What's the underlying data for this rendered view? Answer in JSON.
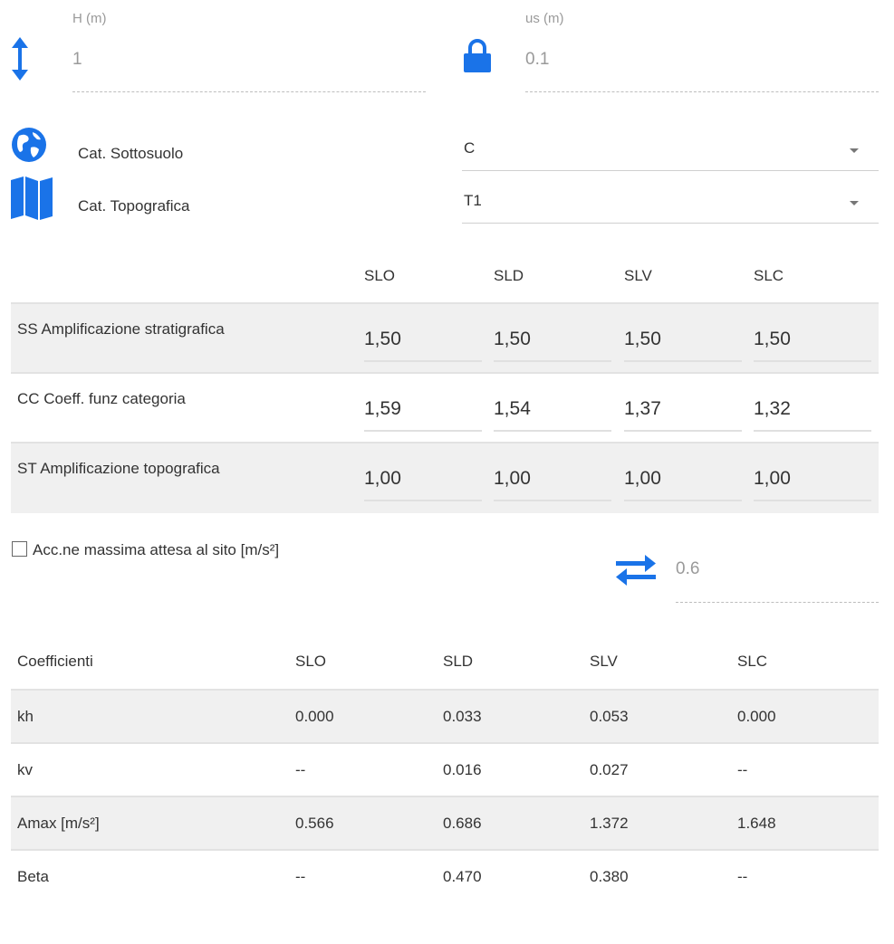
{
  "fields": {
    "h": {
      "label": "H (m)",
      "value": "1"
    },
    "us": {
      "label": "us (m)",
      "value": "0.1"
    }
  },
  "selects": {
    "sottosuolo": {
      "label": "Cat. Sottosuolo",
      "value": "C"
    },
    "topografica": {
      "label": "Cat. Topografica",
      "value": "T1"
    }
  },
  "amp_table": {
    "headers": [
      "SLO",
      "SLD",
      "SLV",
      "SLC"
    ],
    "rows": [
      {
        "label": "SS Amplificazione stratigrafica",
        "values": [
          "1,50",
          "1,50",
          "1,50",
          "1,50"
        ]
      },
      {
        "label": "CC Coeff. funz categoria",
        "values": [
          "1,59",
          "1,54",
          "1,37",
          "1,32"
        ]
      },
      {
        "label": "ST Amplificazione topografica",
        "values": [
          "1,00",
          "1,00",
          "1,00",
          "1,00"
        ]
      }
    ]
  },
  "acc": {
    "checkbox_label": "Acc.ne massima attesa al sito [m/s²]",
    "checked": false,
    "value": "0.6"
  },
  "coeff_table": {
    "headers": [
      "Coefficienti",
      "SLO",
      "SLD",
      "SLV",
      "SLC"
    ],
    "rows": [
      [
        "kh",
        "0.000",
        "0.033",
        "0.053",
        "0.000"
      ],
      [
        "kv",
        "--",
        "0.016",
        "0.027",
        "--"
      ],
      [
        "Amax [m/s²]",
        "0.566",
        "0.686",
        "1.372",
        "1.648"
      ],
      [
        "Beta",
        "--",
        "0.470",
        "0.380",
        "--"
      ]
    ]
  },
  "colors": {
    "accent": "#1a73e8",
    "muted_text": "#9a9a9a",
    "row_shade": "#f0f0f0"
  },
  "icons": {
    "h": "vertical-arrows-icon",
    "us": "lock-icon",
    "sottosuolo": "globe-icon",
    "topografica": "map-icon",
    "acc": "swap-arrows-icon"
  }
}
